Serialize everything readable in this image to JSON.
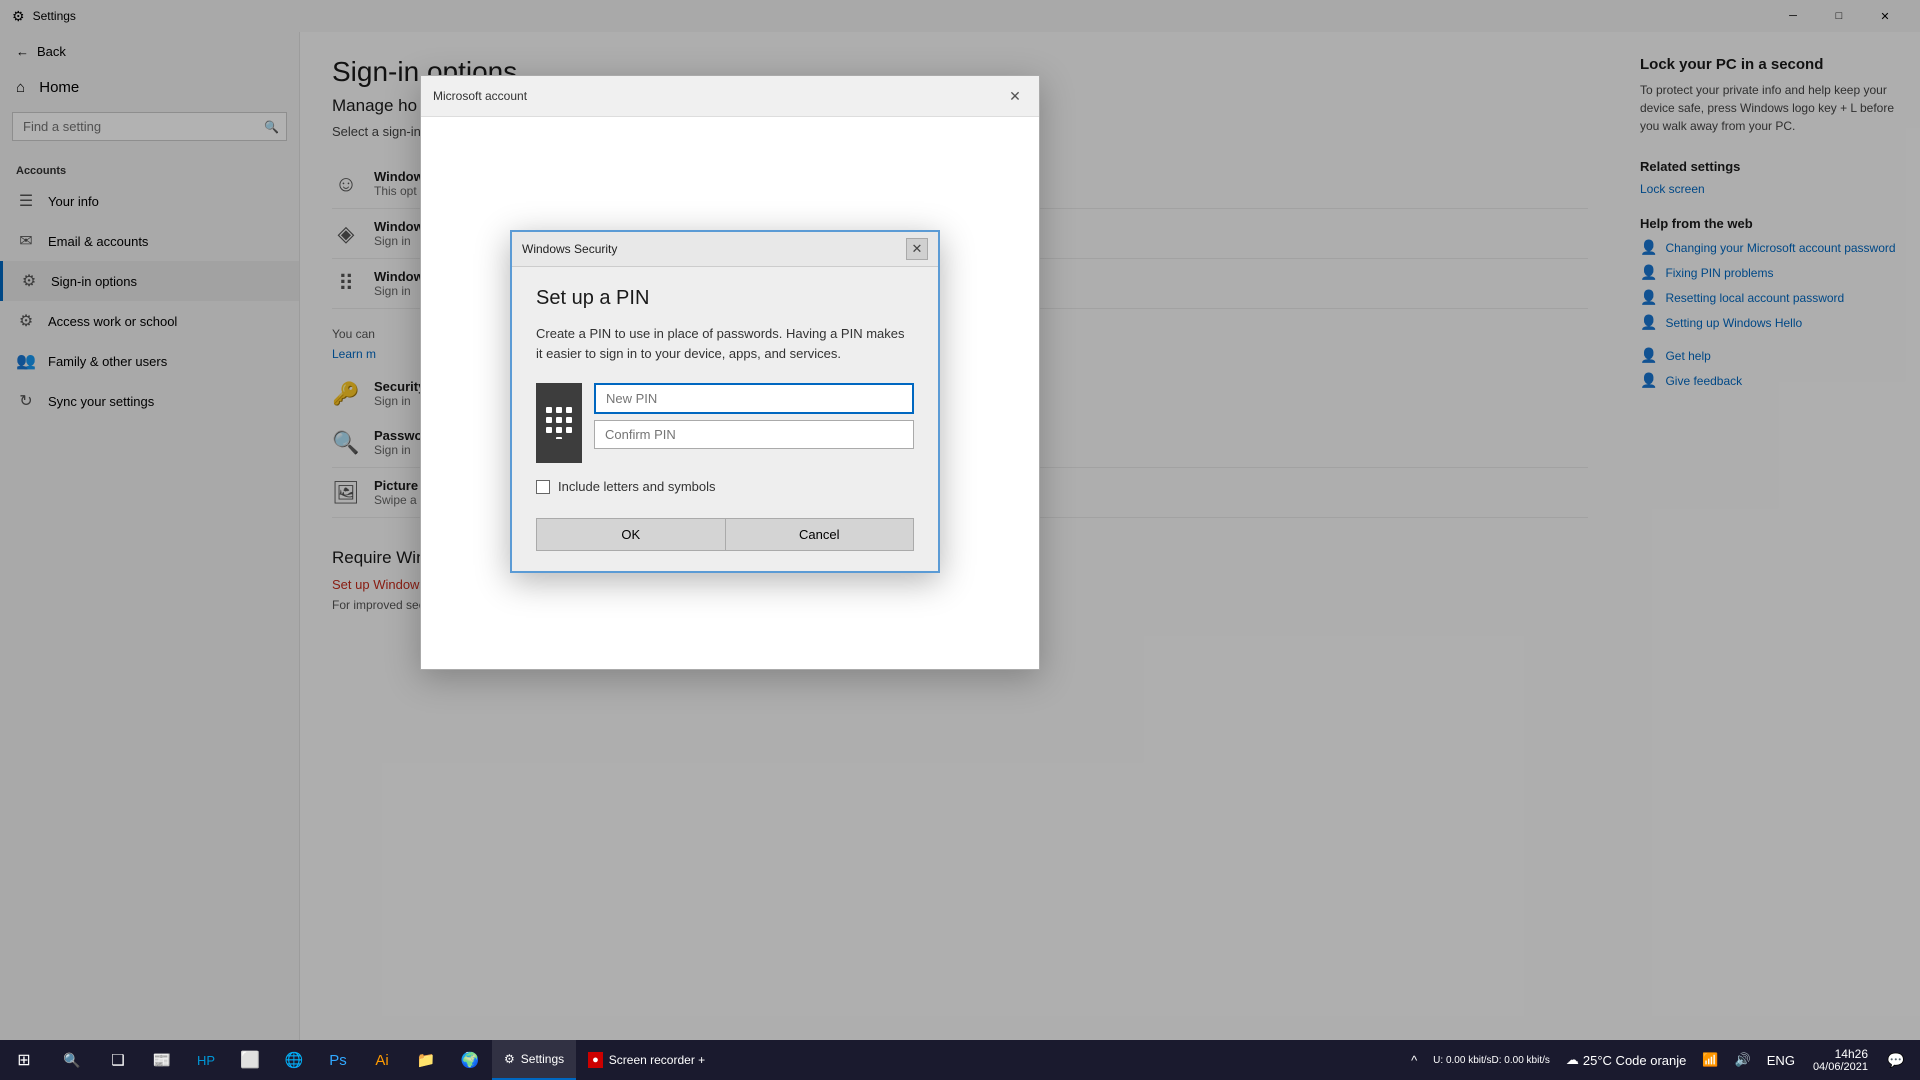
{
  "window": {
    "title": "Settings",
    "min_btn": "─",
    "max_btn": "□",
    "close_btn": "✕"
  },
  "sidebar": {
    "back_label": "Back",
    "home_label": "Home",
    "search_placeholder": "Find a setting",
    "section_label": "Accounts",
    "items": [
      {
        "id": "home",
        "icon": "⌂",
        "label": "Home"
      },
      {
        "id": "your-info",
        "icon": "≡",
        "label": "Your info"
      },
      {
        "id": "email-accounts",
        "icon": "✉",
        "label": "Email & accounts"
      },
      {
        "id": "sign-in-options",
        "icon": "⚙",
        "label": "Sign-in options",
        "active": true
      },
      {
        "id": "access-work",
        "icon": "⚙",
        "label": "Access work or school"
      },
      {
        "id": "family",
        "icon": "👥",
        "label": "Family & other users"
      },
      {
        "id": "sync",
        "icon": "↻",
        "label": "Sync your settings"
      }
    ]
  },
  "main": {
    "page_title": "Sign-in options",
    "manage_title": "Manage ho",
    "select_signin": "Select a sign-in",
    "methods": [
      {
        "icon": "☺",
        "name": "Window",
        "desc": "This opt"
      },
      {
        "icon": "◈",
        "name": "Window",
        "desc": "Sign in"
      },
      {
        "icon": "⠿",
        "name": "Window",
        "desc": "Sign in"
      }
    ],
    "you_can": "You can",
    "learn_more": "Learn m",
    "security_name": "Security",
    "security_desc": "Sign in",
    "password_name": "Passwo",
    "password_desc": "Sign in",
    "picture_name": "Picture",
    "picture_desc": "Swipe a",
    "require_title": "Require Windows Hello sign-in for Microsoft accounts",
    "setup_link": "Set up Windows Hello to change this setting.",
    "require_desc": "For improved security, only allow Windows Hello sign-in for"
  },
  "right_panel": {
    "lock_title": "Lock your PC in a second",
    "lock_desc": "To protect your private info and help keep your device safe, press Windows logo key + L before you walk away from your PC.",
    "related_title": "Related settings",
    "lock_screen_link": "Lock screen",
    "help_title": "Help from the web",
    "links": [
      {
        "icon": "👤",
        "label": "Changing your Microsoft account password"
      },
      {
        "icon": "👤",
        "label": "Fixing PIN problems"
      },
      {
        "icon": "👤",
        "label": "Resetting local account password"
      },
      {
        "icon": "👤",
        "label": "Setting up Windows Hello"
      }
    ],
    "get_help": "Get help",
    "give_feedback": "Give feedback"
  },
  "ms_dialog": {
    "title": "Microsoft account",
    "close_btn": "✕"
  },
  "pin_dialog": {
    "title": "Windows Security",
    "close_btn": "✕",
    "setup_title": "Set up a PIN",
    "desc": "Create a PIN to use in place of passwords. Having a PIN makes it easier to sign in to your device, apps, and services.",
    "new_pin_placeholder": "New PIN",
    "confirm_pin_placeholder": "Confirm PIN",
    "checkbox_label": "Include letters and symbols",
    "ok_label": "OK",
    "cancel_label": "Cancel"
  },
  "taskbar": {
    "start_icon": "⊞",
    "search_icon": "🔍",
    "task_view_icon": "❑",
    "news_icon": "📰",
    "app1": "Settings",
    "app2": "Screen recorder +",
    "time": "14h26",
    "date": "04/06/2021",
    "weather": "25°C Code oranje",
    "network_label": "ENG",
    "upload": "0.00 kbit/s",
    "download": "0.00 kbit/s"
  }
}
